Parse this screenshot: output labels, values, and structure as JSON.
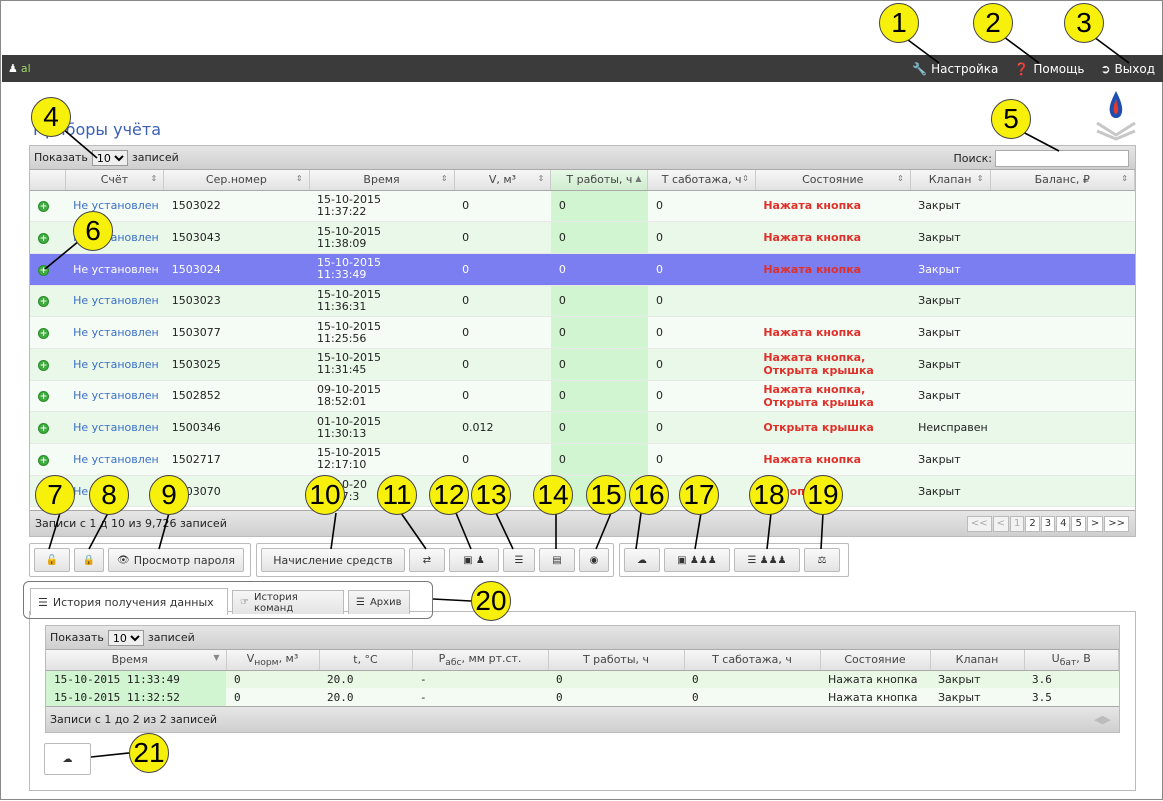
{
  "topbar": {
    "user": "al",
    "settings": "Настройка",
    "help": "Помощь",
    "exit": "Выход"
  },
  "title": "Приборы учёта",
  "table": {
    "show_label": "Показать",
    "show_value": "10",
    "entries_label": "записей",
    "search_label": "Поиск:",
    "columns": [
      "Счёт",
      "Сер.номер",
      "Время",
      "V, м³",
      "T работы, ч",
      "T саботажа, ч",
      "Состояние",
      "Клапан",
      "Баланс, ₽"
    ],
    "rows": [
      {
        "acc": "Не установлен",
        "serial": "1503022",
        "date": "15-10-2015",
        "time": "11:37:22",
        "v": "0",
        "tw": "0",
        "ts": "0",
        "state1": "Нажата кнопка",
        "state2": "",
        "valve": "Закрыт"
      },
      {
        "acc": "Не установлен",
        "serial": "1503043",
        "date": "15-10-2015",
        "time": "11:38:09",
        "v": "0",
        "tw": "0",
        "ts": "0",
        "state1": "Нажата кнопка",
        "state2": "",
        "valve": "Закрыт"
      },
      {
        "acc": "Не установлен",
        "serial": "1503024",
        "date": "15-10-2015",
        "time": "11:33:49",
        "v": "0",
        "tw": "0",
        "ts": "0",
        "state1": "Нажата кнопка",
        "state2": "",
        "valve": "Закрыт"
      },
      {
        "acc": "Не установлен",
        "serial": "1503023",
        "date": "15-10-2015",
        "time": "11:36:31",
        "v": "0",
        "tw": "0",
        "ts": "0",
        "state1": "",
        "state2": "",
        "valve": "Закрыт"
      },
      {
        "acc": "Не установлен",
        "serial": "1503077",
        "date": "15-10-2015",
        "time": "11:25:56",
        "v": "0",
        "tw": "0",
        "ts": "0",
        "state1": "Нажата кнопка",
        "state2": "",
        "valve": "Закрыт"
      },
      {
        "acc": "Не установлен",
        "serial": "1503025",
        "date": "15-10-2015",
        "time": "11:31:45",
        "v": "0",
        "tw": "0",
        "ts": "0",
        "state1": "Нажата кнопка,",
        "state2": "Открыта крышка",
        "valve": "Закрыт"
      },
      {
        "acc": "Не установлен",
        "serial": "1502852",
        "date": "09-10-2015",
        "time": "18:52:01",
        "v": "0",
        "tw": "0",
        "ts": "0",
        "state1": "Нажата кнопка,",
        "state2": "Открыта крышка",
        "valve": "Закрыт"
      },
      {
        "acc": "Не установлен",
        "serial": "1500346",
        "date": "01-10-2015",
        "time": "11:30:13",
        "v": "0.012",
        "tw": "0",
        "ts": "0",
        "state1": "Открыта крышка",
        "state2": "",
        "valve": "Неисправен"
      },
      {
        "acc": "Не установлен",
        "serial": "1502717",
        "date": "15-10-2015",
        "time": "12:17:10",
        "v": "0",
        "tw": "0",
        "ts": "0",
        "state1": "Нажата кнопка",
        "state2": "",
        "valve": "Закрыт"
      },
      {
        "acc": "Не",
        "serial": "1503070",
        "date": "15-10-20",
        "time": "10:07:3",
        "v": "",
        "tw": "",
        "ts": "3",
        "state1": "а кнопка",
        "state2": "",
        "valve": "Закрыт"
      }
    ],
    "footer": "Записи с 1 д   10 из 9,726 записей",
    "pager": [
      "<<",
      "<",
      "1",
      "2",
      "3",
      "4",
      "5",
      ">",
      ">>"
    ]
  },
  "toolbar": {
    "password_view": "Просмотр пароля",
    "accrual": "Начисление средств"
  },
  "tabs": {
    "history": "История получения данных",
    "commands": "История команд",
    "archive": "Архив"
  },
  "history": {
    "show_label": "Показать",
    "show_value": "10",
    "entries_label": "записей",
    "columns": [
      "Время",
      "V",
      "норм",
      ", м³",
      "t, °C",
      "P",
      "абс",
      ", мм рт.ст.",
      "T работы, ч",
      "T саботажа, ч",
      "Состояние",
      "Клапан",
      "U",
      "бат",
      ", В"
    ],
    "rows": [
      {
        "time": "15-10-2015 11:33:49",
        "v": "0",
        "t": "20.0",
        "p": "-",
        "tw": "0",
        "ts": "0",
        "state": "Нажата кнопка",
        "valve": "Закрыт",
        "u": "3.6"
      },
      {
        "time": "15-10-2015 11:32:52",
        "v": "0",
        "t": "20.0",
        "p": "-",
        "tw": "0",
        "ts": "0",
        "state": "Нажата кнопка",
        "valve": "Закрыт",
        "u": "3.5"
      }
    ],
    "footer": "Записи с 1 до 2 из 2 записей"
  },
  "callouts": [
    "1",
    "2",
    "3",
    "4",
    "5",
    "6",
    "7",
    "8",
    "9",
    "10",
    "11",
    "12",
    "13",
    "14",
    "15",
    "16",
    "17",
    "18",
    "19",
    "20",
    "21"
  ]
}
